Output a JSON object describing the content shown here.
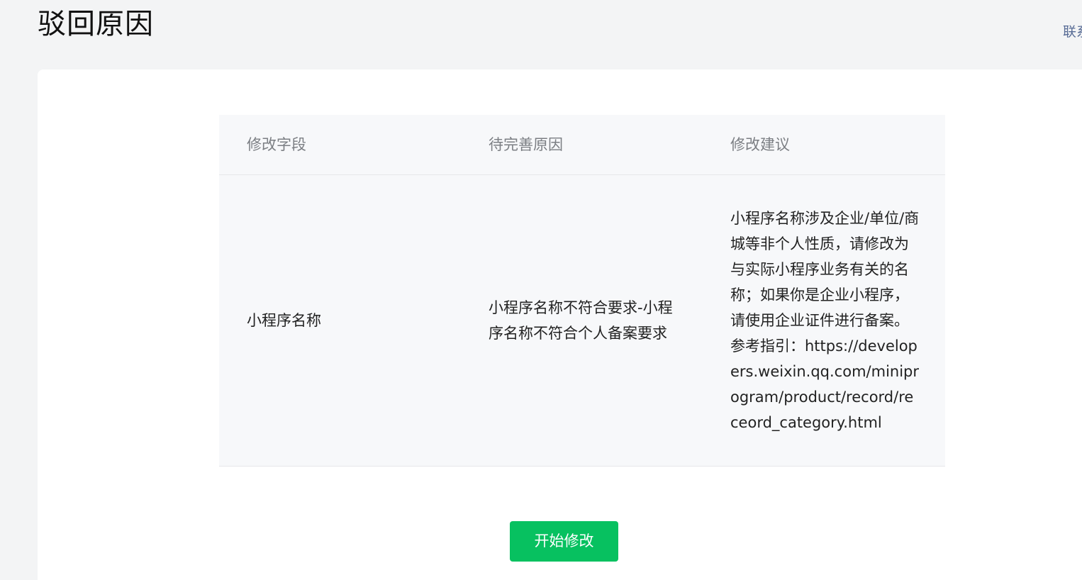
{
  "header": {
    "title": "驳回原因",
    "contact_link": "联系"
  },
  "table": {
    "columns": [
      "修改字段",
      "待完善原因",
      "修改建议"
    ],
    "rows": [
      {
        "field": "小程序名称",
        "reason": "小程序名称不符合要求-小程序名称不符合个人备案要求",
        "suggestion": "小程序名称涉及企业/单位/商城等非个人性质，请修改为与实际小程序业务有关的名称；如果你是企业小程序，请使用企业证件进行备案。参考指引：https://developers.weixin.qq.com/miniprogram/product/record/receord_category.html"
      }
    ]
  },
  "actions": {
    "start_label": "开始修改"
  },
  "colors": {
    "primary": "#07c160",
    "link": "#576b95",
    "page_bg": "#f3f4f5",
    "table_bg": "#f7f8fa"
  }
}
